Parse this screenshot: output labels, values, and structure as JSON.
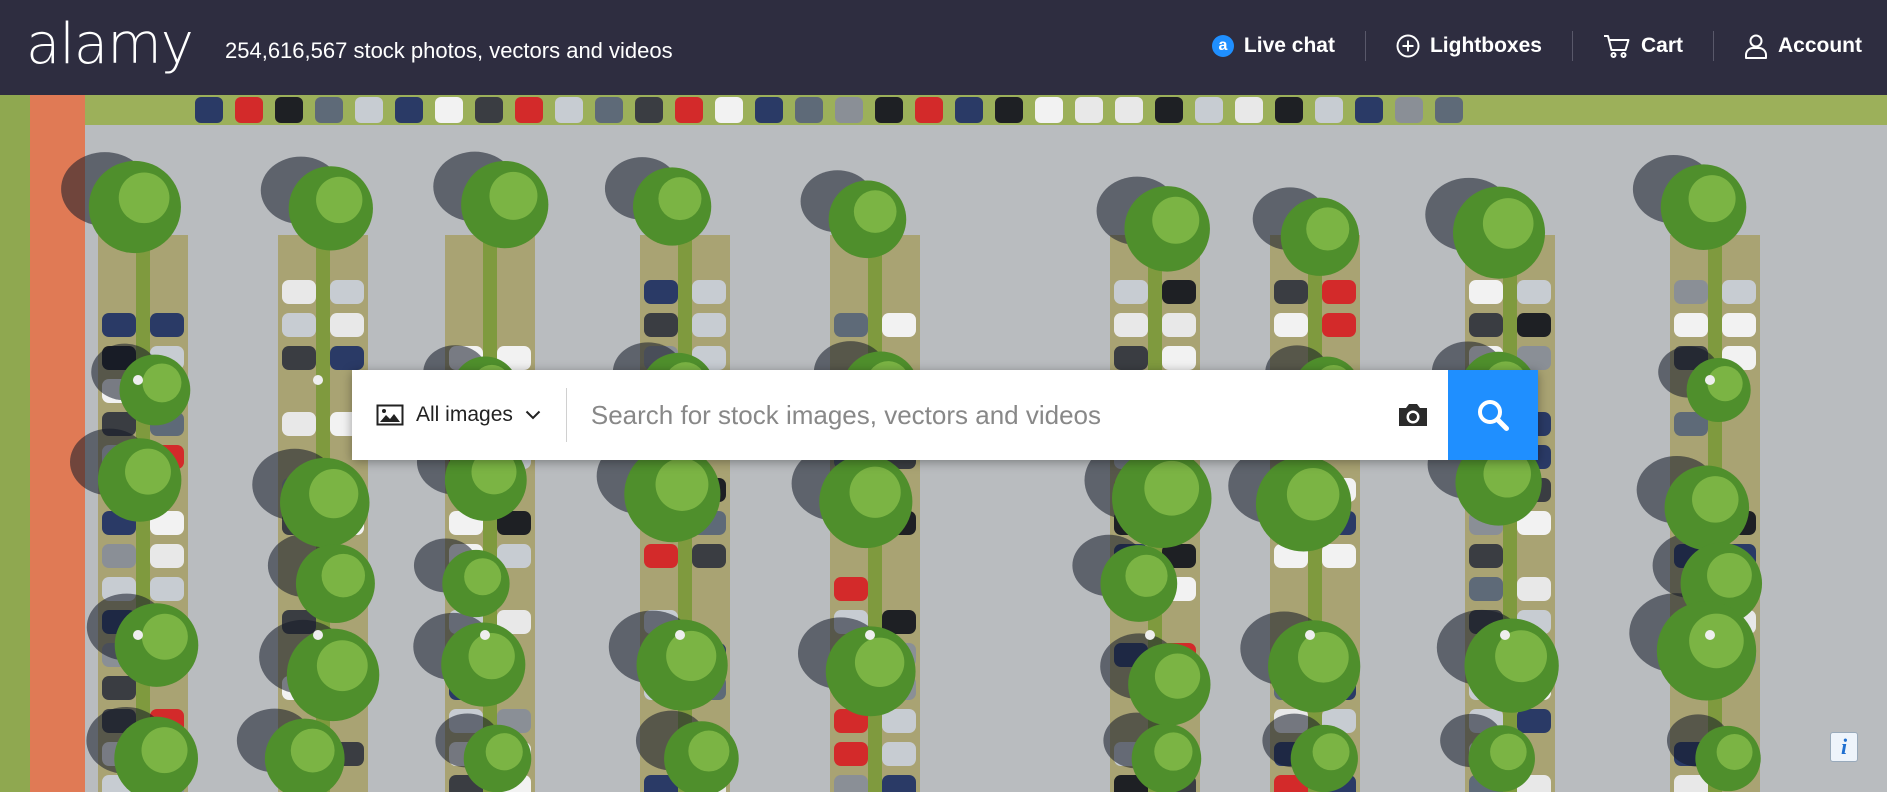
{
  "header": {
    "logo": "alamy",
    "tagline": "254,616,567 stock photos, vectors and videos",
    "nav": {
      "live_chat": "Live chat",
      "live_chat_icon_glyph": "a",
      "lightboxes": "Lightboxes",
      "cart": "Cart",
      "account": "Account"
    }
  },
  "search": {
    "filter_label": "All images",
    "placeholder": "Search for stock images, vectors and videos"
  },
  "info_button": {
    "label": "i"
  },
  "colors": {
    "header_bg": "#2e2d40",
    "accent": "#1f8fff",
    "asphalt": "#b8bbbf",
    "walkway": "#e07a55",
    "grass": "#9cb05a",
    "tree": "#4f8f2c"
  },
  "icons": [
    "chat-icon",
    "plus-circle-icon",
    "cart-icon",
    "user-icon",
    "image-icon",
    "chevron-down-icon",
    "camera-icon",
    "search-icon",
    "info-icon"
  ]
}
